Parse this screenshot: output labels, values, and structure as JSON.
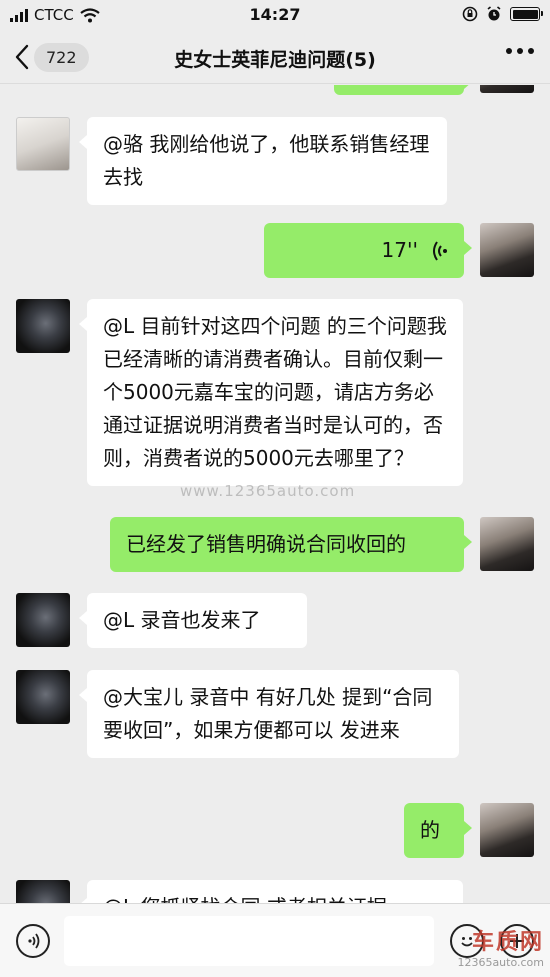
{
  "status_bar": {
    "carrier": "CTCC",
    "time": "14:27"
  },
  "nav": {
    "unread_count": "722",
    "title": "史女士英菲尼迪问题(5)"
  },
  "messages": [
    {
      "side": "in",
      "text": "@骆 我刚给他说了，他联系销售经理去找"
    },
    {
      "side": "out",
      "type": "voice",
      "duration": "17''"
    },
    {
      "side": "in",
      "text": "@L 目前针对这四个问题 的三个问题我已经清晰的请消费者确认。目前仅剩一个5000元嘉车宝的问题，请店方务必通过证据说明消费者当时是认可的，否则，消费者说的5000元去哪里了？"
    },
    {
      "side": "out",
      "text": "已经发了销售明确说合同收回的"
    },
    {
      "side": "in",
      "text": "@L 录音也发来了"
    },
    {
      "side": "in",
      "text": "@大宝儿 录音中 有好几处 提到“合同要收回”，如果方便都可以 发进来"
    },
    {
      "side": "out",
      "text": "的"
    },
    {
      "side": "in",
      "text": "@L 您抓紧找合同 或者相关证据"
    }
  ],
  "watermark": "www.12365auto.com",
  "brand": {
    "name": "车质网",
    "url": "12365auto.com"
  }
}
